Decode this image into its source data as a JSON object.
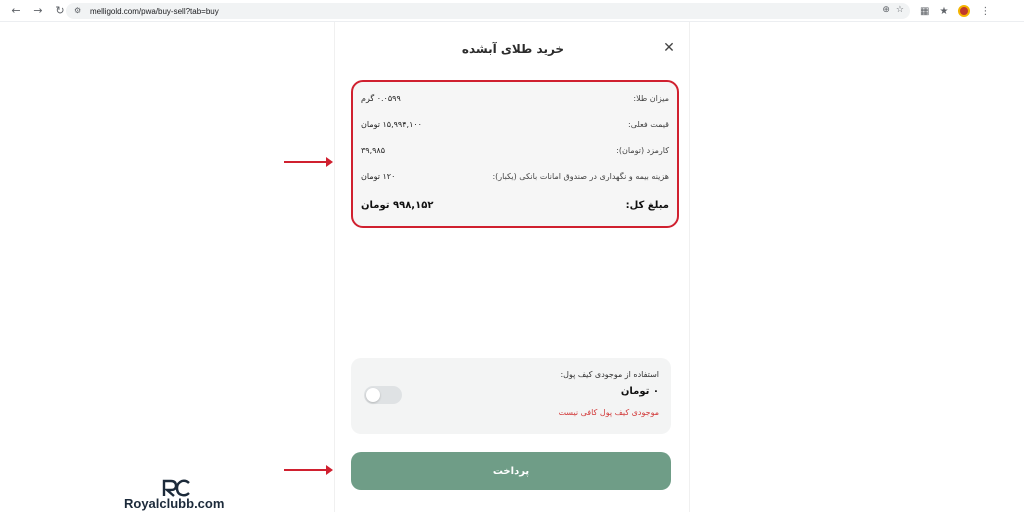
{
  "browser": {
    "url": "melligold.com/pwa/buy-sell?tab=buy"
  },
  "modal": {
    "title": "خرید طلای آبشده",
    "summary": {
      "gold_amount_label": "میزان طلا:",
      "gold_amount_value": "۰.۰۵۹۹ گرم",
      "current_price_label": "قیمت فعلی:",
      "current_price_value": "۱۵,۹۹۴,۱۰۰ تومان",
      "fee_label": "کارمزد (تومان):",
      "fee_value": "۳۹,۹۸۵",
      "insurance_label": "هزینه بیمه و نگهداری در صندوق امانات بانکی (یکبار):",
      "insurance_value": "۱۲۰ تومان",
      "total_label": "مبلغ کل:",
      "total_value": "۹۹۸,۱۵۲ تومان"
    },
    "wallet": {
      "label": "استفاده از موجودی کیف پول:",
      "balance": "۰ تومان",
      "warning": "موجودی کیف پول کافی نیست",
      "toggle_on": false
    },
    "pay_button": "پرداخت"
  },
  "watermark": {
    "text": "Royalclubb.com"
  },
  "colors": {
    "highlight": "#d0202f",
    "pay_button": "#6f9d87",
    "warning": "#d23a3a"
  }
}
